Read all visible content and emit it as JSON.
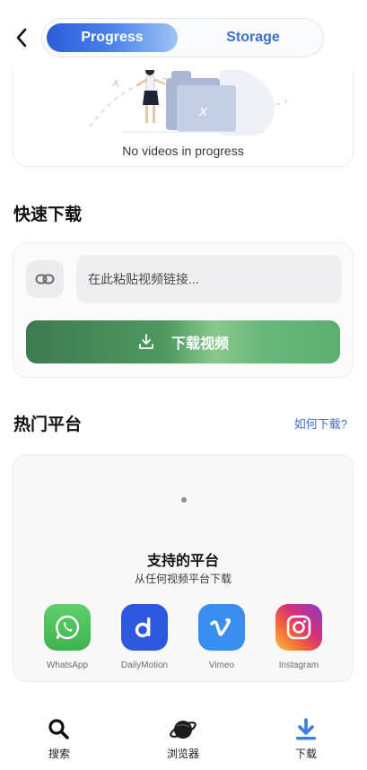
{
  "header": {
    "tabs": [
      {
        "label": "Progress",
        "active": true
      },
      {
        "label": "Storage",
        "active": false
      }
    ]
  },
  "progress": {
    "empty_text": "No videos in progress"
  },
  "quick_download": {
    "title": "快速下载",
    "url_placeholder": "在此粘贴视频链接...",
    "url_value": "",
    "button_label": "下载视频"
  },
  "platforms": {
    "title": "热门平台",
    "help_link": "如何下载?",
    "support_title": "支持的平台",
    "support_subtitle": "从任何视频平台下载",
    "items": [
      {
        "label": "WhatsApp",
        "icon": "whatsapp-icon",
        "color": "#4cbf5a"
      },
      {
        "label": "DailyMotion",
        "icon": "dailymotion-icon",
        "color": "#2f58e0"
      },
      {
        "label": "Vimeo",
        "icon": "vimeo-icon",
        "color": "#3a8ef0"
      },
      {
        "label": "Instagram",
        "icon": "instagram-icon",
        "color": "#d6307a"
      }
    ]
  },
  "bottom_nav": {
    "items": [
      {
        "label": "搜索",
        "icon": "search-icon",
        "active": false
      },
      {
        "label": "浏览器",
        "icon": "planet-icon",
        "active": false
      },
      {
        "label": "下载",
        "icon": "download-icon",
        "active": true
      }
    ]
  },
  "colors": {
    "accent_blue": "#3b6fd4",
    "download_green": "#4f9a60"
  }
}
